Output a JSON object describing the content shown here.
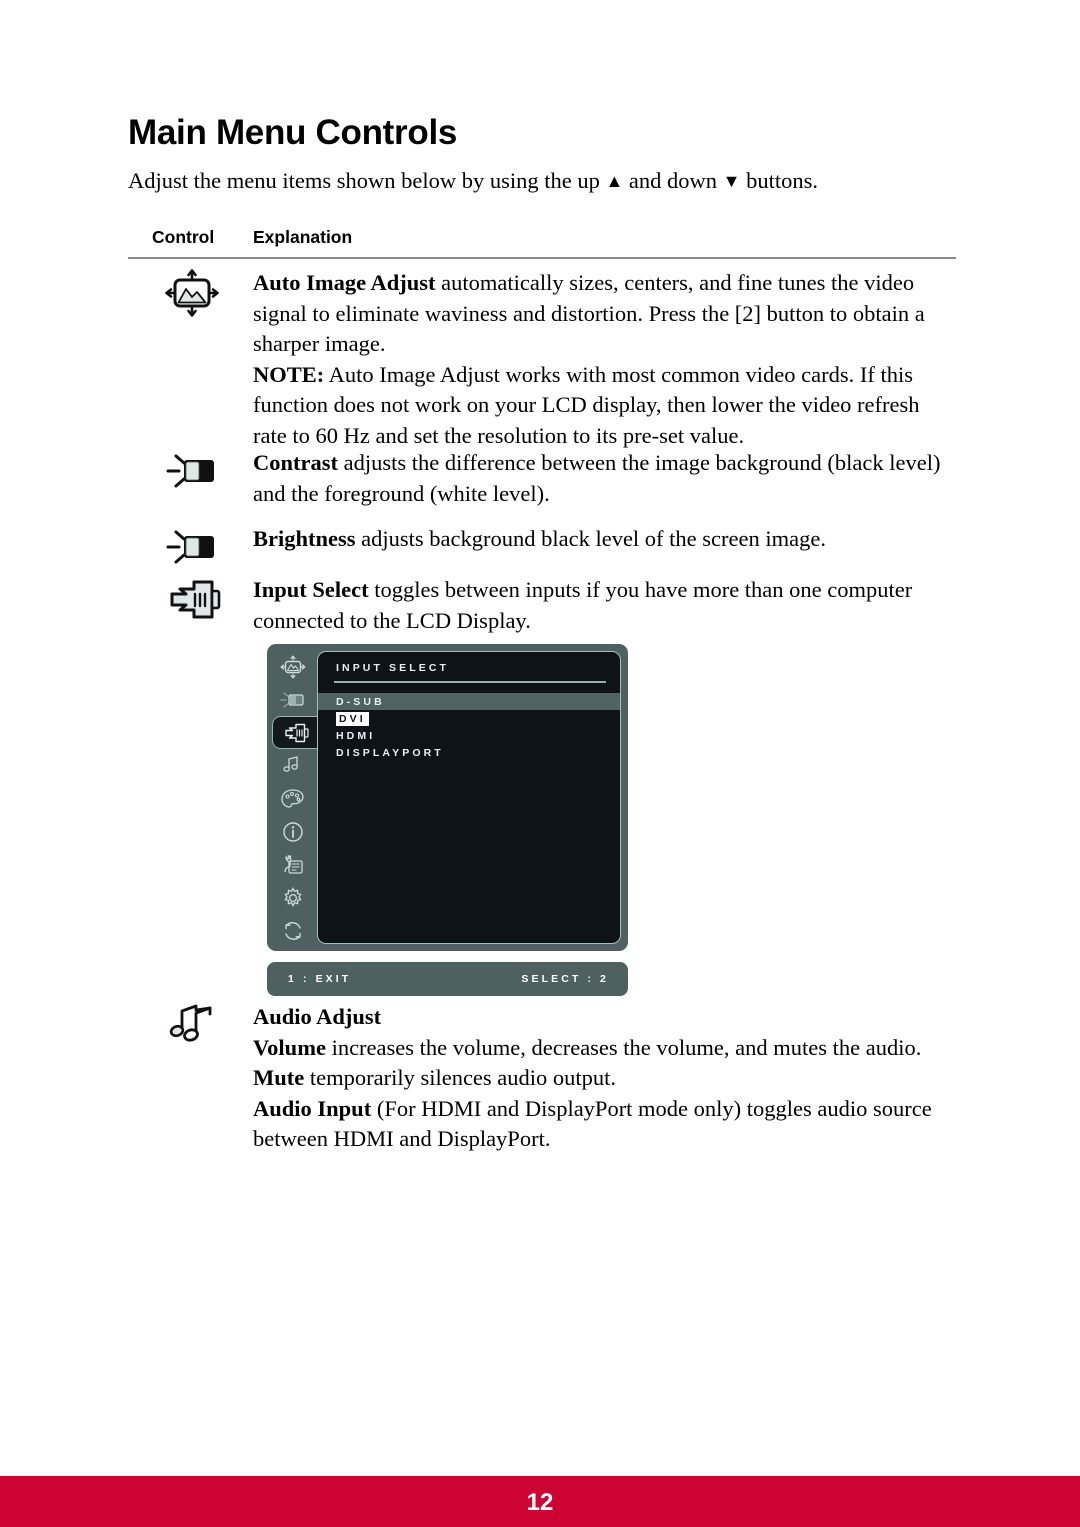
{
  "document": {
    "title": "Main Menu Controls",
    "intro_prefix": "Adjust the menu items shown below by using the up ",
    "intro_up_arrow": "▲",
    "intro_mid": " and down ",
    "intro_down_arrow": "▼",
    "intro_suffix": " buttons.",
    "intro_full": "Adjust the menu items shown below by using the up ▲ and down ▼ buttons."
  },
  "table": {
    "headers": {
      "control": "Control",
      "explanation": "Explanation"
    },
    "rows": [
      {
        "icon": "auto-image-adjust-icon",
        "term": "Auto Image Adjust",
        "body": " automatically sizes, centers, and fine tunes the video signal to eliminate waviness and distortion. Press the [2] button to obtain a sharper image.",
        "note_label": "NOTE:",
        "note_body": " Auto Image Adjust works with most common video cards. If this function does not work on your LCD display, then lower the video refresh rate to 60 Hz and set the resolution to its pre-set value."
      },
      {
        "icon": "contrast-icon",
        "term": "Contrast",
        "body": " adjusts the difference between the image background (black level) and the foreground (white level)."
      },
      {
        "icon": "brightness-icon",
        "term": "Brightness",
        "body": " adjusts background black level of the screen image."
      },
      {
        "icon": "input-select-icon",
        "term": "Input Select",
        "body": " toggles between inputs if you have more than one computer connected to the LCD Display."
      },
      {
        "icon": "audio-adjust-icon",
        "title": "Audio Adjust",
        "lines": [
          {
            "term": "Volume",
            "body": " increases the volume, decreases the volume, and mutes the audio."
          },
          {
            "term": "Mute",
            "body": " temporarily silences audio output."
          },
          {
            "term": "Audio Input",
            "body": " (For HDMI and DisplayPort mode only) toggles audio source between HDMI and DisplayPort."
          }
        ]
      }
    ]
  },
  "osd": {
    "heading": "INPUT SELECT",
    "sidebar_icons": [
      "auto-image-adjust-icon",
      "contrast-brightness-icon",
      "input-select-icon",
      "audio-adjust-icon",
      "color-adjust-icon",
      "information-icon",
      "manual-image-adjust-icon",
      "setup-menu-icon",
      "memory-recall-icon"
    ],
    "active_sidebar_index": 2,
    "items": [
      {
        "label": "D-SUB",
        "state": "row-highlight"
      },
      {
        "label": "DVI",
        "state": "boxed-selected"
      },
      {
        "label": "HDMI",
        "state": "normal"
      },
      {
        "label": "DISPLAYPORT",
        "state": "normal"
      }
    ],
    "footer_left": "1 : EXIT",
    "footer_right": "SELECT : 2",
    "colors": {
      "panel": "#4f6060",
      "screen": "#0d1316",
      "text": "#e8f0f0",
      "row_highlight": "#4f6363"
    }
  },
  "footer": {
    "page_number": "12",
    "bar_color": "#cc0333"
  }
}
